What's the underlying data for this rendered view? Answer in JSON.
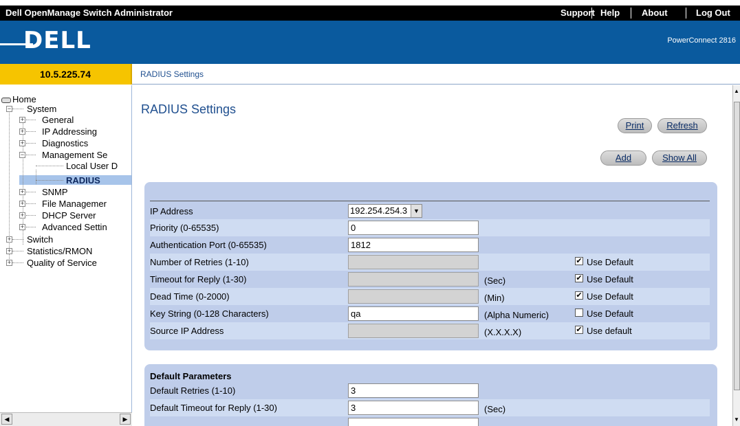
{
  "app": {
    "title": "Dell OpenManage Switch Administrator",
    "links": [
      "Support",
      "Help",
      "About",
      "Log Out"
    ],
    "logo_text": "DELL",
    "product": "PowerConnect 2816"
  },
  "address": "10.5.225.74",
  "breadcrumb": "RADIUS Settings",
  "sidebar": {
    "items": [
      {
        "label": "Home"
      },
      {
        "label": "System"
      },
      {
        "label": "General"
      },
      {
        "label": "IP Addressing"
      },
      {
        "label": "Diagnostics"
      },
      {
        "label": "Management Se"
      },
      {
        "label": "Local User D"
      },
      {
        "label": "RADIUS"
      },
      {
        "label": "SNMP"
      },
      {
        "label": "File Managemer"
      },
      {
        "label": "DHCP Server"
      },
      {
        "label": "Advanced Settin"
      },
      {
        "label": "Switch"
      },
      {
        "label": "Statistics/RMON"
      },
      {
        "label": "Quality of Service"
      }
    ]
  },
  "main": {
    "title": "RADIUS Settings",
    "buttons": {
      "print": "Print",
      "refresh": "Refresh",
      "add": "Add",
      "show_all": "Show All"
    },
    "settings": {
      "ip_address_label": "IP Address",
      "ip_address_value": "192.254.254.3",
      "rows": [
        {
          "label": "Priority (0-65535)",
          "value": "0",
          "unit": "",
          "check": ""
        },
        {
          "label": "Authentication Port (0-65535)",
          "value": "1812",
          "unit": "",
          "check": ""
        },
        {
          "label": "Number of Retries (1-10)",
          "value": "",
          "unit": "",
          "check": "Use Default",
          "checked": true
        },
        {
          "label": "Timeout for Reply (1-30)",
          "value": "",
          "unit": "(Sec)",
          "check": "Use Default",
          "checked": true
        },
        {
          "label": "Dead Time (0-2000)",
          "value": "",
          "unit": "(Min)",
          "check": "Use Default",
          "checked": true
        },
        {
          "label": "Key String (0-128 Characters)",
          "value": "qa",
          "unit": "(Alpha Numeric)",
          "check": "Use Default",
          "checked": false
        },
        {
          "label": "Source IP Address",
          "value": "",
          "unit": "(X.X.X.X)",
          "check": "Use default",
          "checked": true
        }
      ]
    },
    "defaults": {
      "heading": "Default Parameters",
      "rows": [
        {
          "label": "Default Retries (1-10)",
          "value": "3",
          "unit": ""
        },
        {
          "label": "Default Timeout for Reply (1-30)",
          "value": "3",
          "unit": "(Sec)"
        }
      ]
    }
  }
}
